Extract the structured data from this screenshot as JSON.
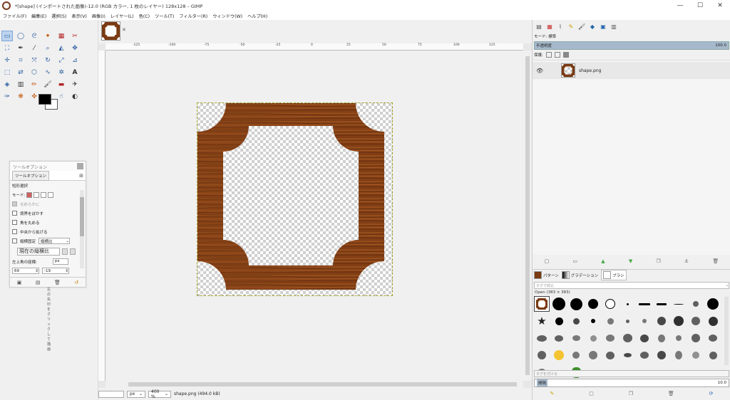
{
  "window": {
    "title": "*[shape] (インポートされた画像)-12.0 (RGB カラー, 1 枚のレイヤー) 128x128 – GIMP",
    "minimize": "—",
    "maximize": "☐",
    "close": "✕"
  },
  "menu": [
    "ファイル(F)",
    "編集(E)",
    "選択(S)",
    "表示(V)",
    "画像(I)",
    "レイヤー(L)",
    "色(C)",
    "ツール(T)",
    "フィルター(R)",
    "ウィンドウ(W)",
    "ヘルプ(H)"
  ],
  "tool_options": {
    "dock_title": "ツールオプション",
    "tab_label": "ツールオプション",
    "section_title": "短形選択",
    "mode_label": "モード:",
    "antialias": "なめらかに",
    "feather": "境界をぼかす",
    "rounded": "角を丸める",
    "from_center": "中央から拡げる",
    "fixed_label": "縦横固定",
    "fixed_value": "縦横比",
    "ratio_field": "現在の縦横比",
    "position_label": "左上角の座標:",
    "pos_x": "69",
    "pos_y": "-19",
    "unit": "px"
  },
  "vertical_note": "左の矢印をクリックして描画",
  "image_tab": {
    "close": "✕"
  },
  "ruler_ticks": [
    "-125",
    "-100",
    "-75",
    "-50",
    "-25",
    "0",
    "25",
    "50",
    "75",
    "100",
    "125"
  ],
  "status": {
    "coords": "",
    "unit": "px",
    "zoom": "400 %",
    "filename": "shape.png (494.0 kB)"
  },
  "layers": {
    "mode_label": "モード: 標準",
    "opacity_label": "不透明度",
    "opacity_value": "100.0",
    "lock_label": "保護:",
    "items": [
      {
        "name": "shape.png",
        "visible": true
      }
    ]
  },
  "brushes": {
    "tab_pattern": "パターン",
    "tab_gradient": "グラデーション",
    "tab_brush": "ブラシ",
    "filter_placeholder": "タグで絞込",
    "caption": "Open (383 × 383)",
    "tag_placeholder": "タグを付ける",
    "spacing_label": "間隔",
    "spacing_value": "10.0"
  },
  "colors": {
    "wood_dark": "#5a2a0c",
    "wood_mid": "#8b4518",
    "wood_light": "#a85a26",
    "selection": "#a1a128",
    "highlight": "#bcd3ee"
  }
}
